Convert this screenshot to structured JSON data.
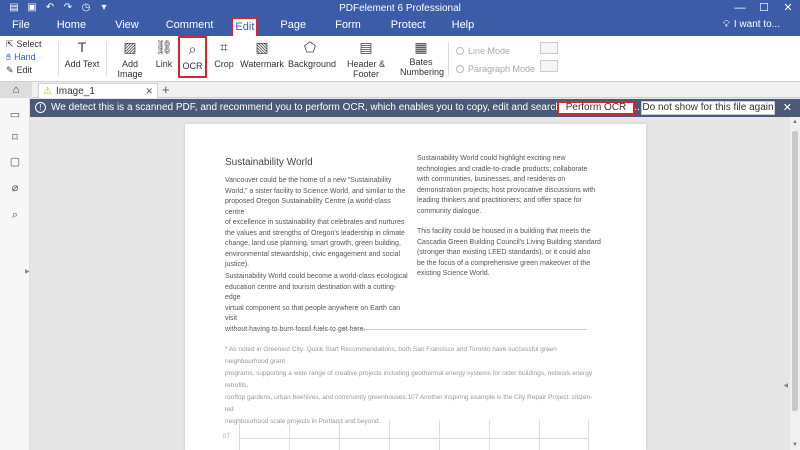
{
  "app_title": "PDFelement 6 Professional",
  "menu": {
    "items": [
      "File",
      "Home",
      "View",
      "Comment",
      "Edit",
      "Page",
      "Form",
      "Protect",
      "Help"
    ],
    "active": "Edit",
    "search": "I want to..."
  },
  "toolbar": {
    "select": "Select",
    "hand": "Hand",
    "edit": "Edit",
    "add_text": "Add Text",
    "add_image": "Add Image",
    "link": "Link",
    "ocr": "OCR",
    "crop": "Crop",
    "watermark": "Watermark",
    "background": "Background",
    "header_footer": "Header & Footer",
    "bates": "Bates",
    "numbering": "Numbering",
    "line_mode": "Line Mode",
    "paragraph_mode": "Paragraph Mode"
  },
  "tabs": {
    "doc_tab": "Image_1"
  },
  "notification": {
    "message": "We detect this is a scanned PDF, and recommend you to perform OCR, which enables you to copy, edit and search texts from scan...",
    "perform_ocr": "Perform OCR",
    "do_not_show": "Do not show for this file again"
  },
  "document": {
    "title": "Sustainability World",
    "left_para1": "Vancouver could be the home of a new “Sustainability\nWorld,” a sister facility to Science World, and similar to the\nproposed Oregon Sustainability Centre (a world-class centre\nof excellence in sustainability that celebrates and nurtures\nthe values and strengths of Oregon's leadership in climate\nchange, land use planning, smart growth, green building,\nenvironmental stewardship, civic engagement and social\njustice).",
    "left_para2": "Sustainability World could become a world-class ecological\neducation centre and tourism destination with a cutting-edge\nvirtual component so that people anywhere on Earth can visit\nwithout having to burn fossil fuels to get here.",
    "right_para1": "Sustainability World could highlight exciting new\ntechnologies and cradle-to-cradle products; collaborate\nwith communities, businesses, and residents on\ndemonstration projects; host provocative discussions with\nleading thinkers and practitioners; and offer space for\ncommunity dialogue.",
    "right_para2": "This facility could be housed in a building that meets the\nCascadia Green Building Council's Living Building standard\n(stronger than existing LEED standards), or it could also\nbe the focus of a comprehensive green makeover of the\nexisting Science World.",
    "footnote": "* As noted in Greenest City: Quick Start Recommendations, both San Francisco and Toronto have successful green neighbourhood grant\nprograms, supporting a wide range of creative projects including geothermal energy systems for older buildings, network energy retrofits,\nrooftop gardens, urban beehives, and community greenhouses.107 Another inspiring example is the City Repair Project: citizen-led\nneighbourhood scale projects in Portland and beyond.",
    "page_number": "07"
  },
  "colors": {
    "title_bar": "#3c5ca8",
    "notification_bar": "#4a5a78",
    "highlight": "#d6252d"
  }
}
